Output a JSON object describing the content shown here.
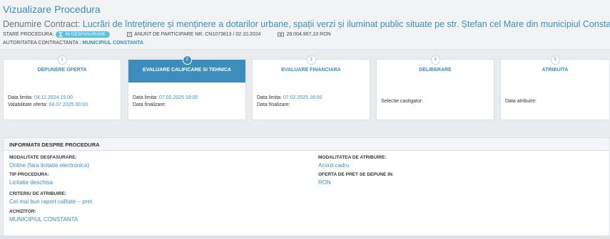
{
  "header": {
    "title": "Vizualizare Procedura",
    "contract_prefix": "Denumire Contract:",
    "contract_name": "Lucrări de întreținere și menținere a dotarilor urbane, spații verzi și iluminat public situate pe str. Ștefan cel Mare din municipiul Constanța",
    "status_label": "STARE PROCEDURA:",
    "status_badge": "IN DESFASURARE",
    "notice": "ANUNT DE PARTICIPARE NR. CN1073813 / 02.10.2024",
    "value": "28.004.967,10",
    "currency": "RON",
    "authority_label": "AUTORITATEA CONTRACTANTA :",
    "authority_value": "MUNICIPIUL CONSTANTA"
  },
  "steps": [
    {
      "num": "1",
      "label": "DEPUNERE OFERTA",
      "lines": [
        {
          "label": "Data limita:",
          "value": "04.11.2024 15:00"
        },
        {
          "label": "Valabilitate oferta:",
          "value": "04.07.2025 00:00"
        }
      ]
    },
    {
      "num": "2",
      "label": "EVALUARE CALIFICARE SI TEHNICA",
      "lines": [
        {
          "label": "Data limita:",
          "value": "07.02.2025 18:00"
        },
        {
          "label": "Data finalizare:",
          "value": ""
        }
      ]
    },
    {
      "num": "3",
      "label": "EVALUARE FINANCIARA",
      "lines": [
        {
          "label": "Data limita:",
          "value": "07.02.2025 18:00"
        },
        {
          "label": "Data finalizare:",
          "value": ""
        }
      ]
    },
    {
      "num": "4",
      "label": "DELIBERARE",
      "lines": [
        {
          "label": "Selectie castigator:",
          "value": ""
        }
      ]
    },
    {
      "num": "5",
      "label": "ATRIBUITA",
      "lines": [
        {
          "label": "Data atribuire:",
          "value": ""
        }
      ]
    }
  ],
  "info": {
    "title": "INFORMATII DESPRE PROCEDURA",
    "left": [
      {
        "label": "MODALITATE DESFASURARE:",
        "value": "Online (fara licitatie electronica)"
      },
      {
        "label": "TIP PROCEDURA:",
        "value": "Licitatie deschisa"
      },
      {
        "label": "CRITERIU DE ATRIBUIRE:",
        "value": "Cel mai bun raport calitate – pret"
      },
      {
        "label": "ACHIZITOR:",
        "value": "MUNICIPIUL CONSTANTA"
      }
    ],
    "right": [
      {
        "label": "MODALITATEA DE ATRIBUIRE:",
        "value": "Acord-cadru"
      },
      {
        "label": "OFERTA DE PRET SE DEPUNE IN:",
        "value": "RON"
      }
    ]
  }
}
